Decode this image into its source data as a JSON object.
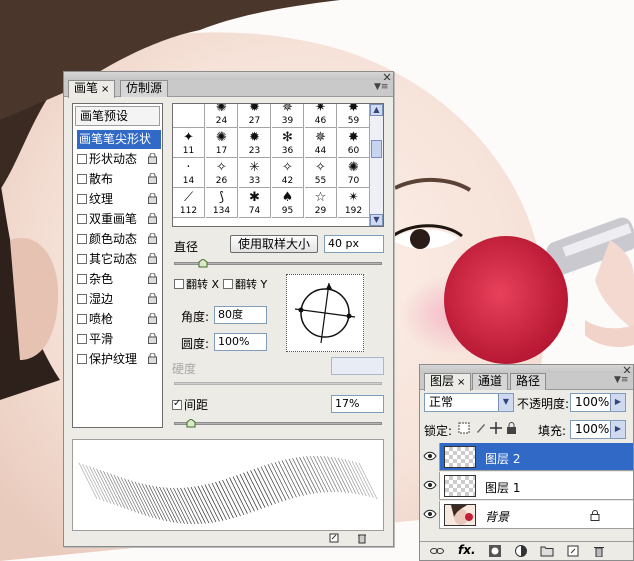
{
  "brush_panel": {
    "tabs": [
      {
        "label": "画笔",
        "close": "×"
      },
      {
        "label": "仿制源"
      }
    ],
    "window_close": "×",
    "menu_icon": "≡",
    "presets_label": "画笔预设",
    "options": [
      {
        "label": "画笔笔尖形状",
        "selected": true
      },
      {
        "label": "形状动态",
        "checked": false,
        "locked": true
      },
      {
        "label": "散布",
        "checked": false,
        "locked": true
      },
      {
        "label": "纹理",
        "checked": false,
        "locked": true
      },
      {
        "label": "双重画笔",
        "checked": false,
        "locked": true
      },
      {
        "label": "颜色动态",
        "checked": false,
        "locked": true
      },
      {
        "label": "其它动态",
        "checked": false,
        "locked": true
      },
      {
        "label": "杂色",
        "checked": false,
        "locked": true
      },
      {
        "label": "湿边",
        "checked": false,
        "locked": true
      },
      {
        "label": "喷枪",
        "checked": false,
        "locked": true
      },
      {
        "label": "平滑",
        "checked": false,
        "locked": true
      },
      {
        "label": "保护纹理",
        "checked": false,
        "locked": true
      }
    ],
    "brush_sizes": [
      [
        "24",
        "27",
        "39",
        "46",
        "59"
      ],
      [
        "11",
        "17",
        "23",
        "36",
        "44",
        "60"
      ],
      [
        "14",
        "26",
        "33",
        "42",
        "55",
        "70"
      ],
      [
        "112",
        "134",
        "74",
        "95",
        "29",
        "192"
      ]
    ],
    "diameter_label": "直径",
    "use_sample_size_label": "使用取样大小",
    "diameter_value": "40 px",
    "diameter_slider_fraction": 0.14,
    "flip_x_label": "翻转 X",
    "flip_y_label": "翻转 Y",
    "angle_label": "角度:",
    "angle_value": "80度",
    "roundness_label": "圆度:",
    "roundness_value": "100%",
    "hardness_label": "硬度",
    "spacing_label": "间距",
    "spacing_checked": true,
    "spacing_value": "17%",
    "spacing_slider_fraction": 0.08
  },
  "layers_panel": {
    "tabs": [
      {
        "label": "图层",
        "close": "×"
      },
      {
        "label": "通道"
      },
      {
        "label": "路径"
      }
    ],
    "window_close": "×",
    "blend_mode": "正常",
    "opacity_label": "不透明度:",
    "opacity_value": "100%",
    "lock_label": "锁定:",
    "fill_label": "填充:",
    "fill_value": "100%",
    "layers": [
      {
        "name": "图层 2",
        "selected": true,
        "visible": true
      },
      {
        "name": "图层 1",
        "selected": false,
        "visible": true
      },
      {
        "name": "背景",
        "selected": false,
        "visible": true,
        "locked": true
      }
    ],
    "footer_icons": [
      "link-icon",
      "fx-icon",
      "mask-icon",
      "adjustment-icon",
      "folder-icon",
      "new-layer-icon",
      "trash-icon"
    ],
    "fx_label": "fx."
  },
  "colors": {
    "panel_bg": "#ecebe6",
    "selection_blue": "#3169c6",
    "brush_red": "#d21f3c"
  }
}
